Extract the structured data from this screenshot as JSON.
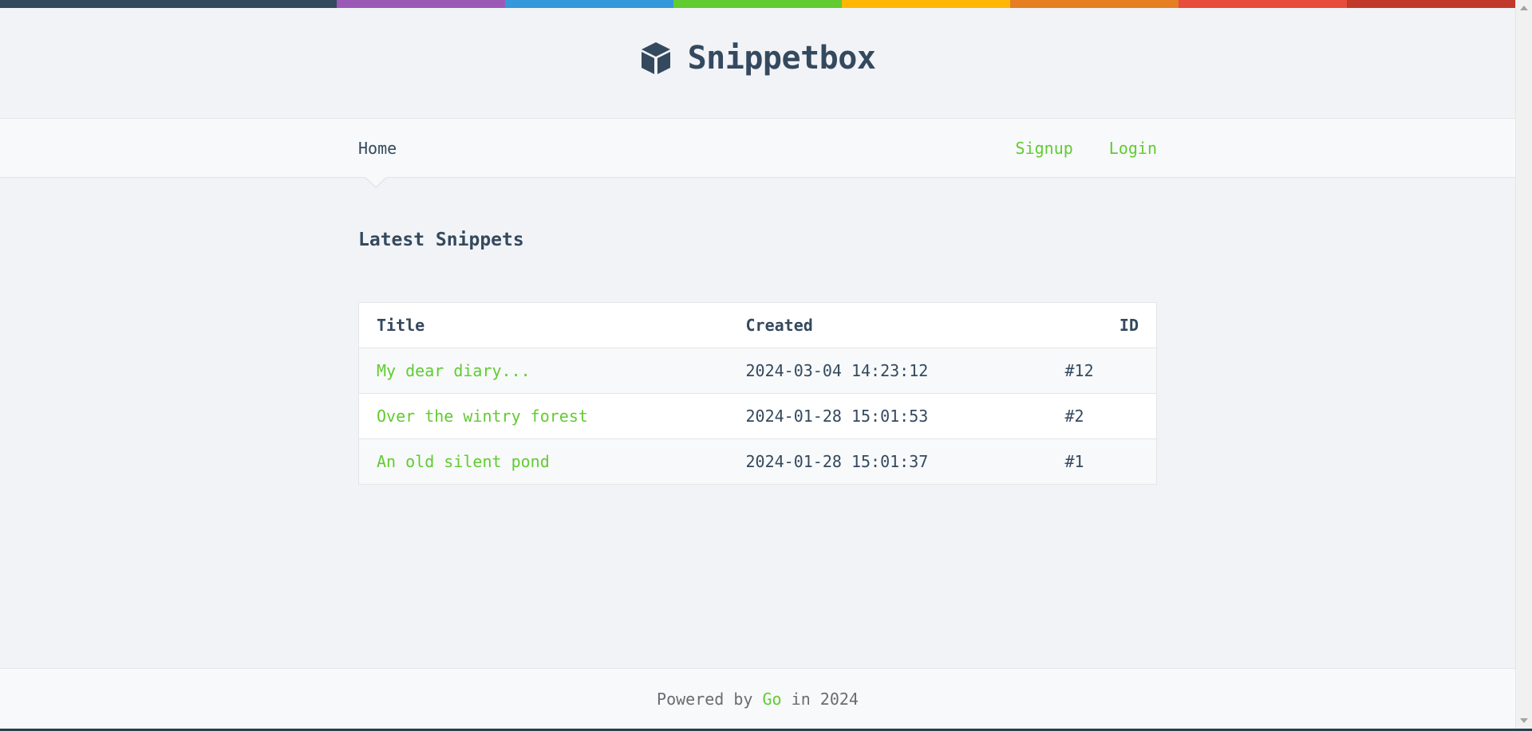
{
  "stripe_colors": [
    "#34495e",
    "#34495e",
    "#9b59b6",
    "#3498db",
    "#62cb31",
    "#ffb606",
    "#e67e22",
    "#e74c3c",
    "#c0392b"
  ],
  "header": {
    "brand_title": "Snippetbox",
    "logo_icon": "cube-icon",
    "text_color": "#34495e"
  },
  "nav": {
    "home_label": "Home",
    "signup_label": "Signup",
    "login_label": "Login",
    "link_color": "#62cb31"
  },
  "main": {
    "title": "Latest Snippets",
    "table": {
      "headers": {
        "title": "Title",
        "created": "Created",
        "id": "ID"
      },
      "rows": [
        {
          "title": "My dear diary...",
          "created": "2024-03-04 14:23:12",
          "id": "#12"
        },
        {
          "title": "Over the wintry forest",
          "created": "2024-01-28 15:01:53",
          "id": "#2"
        },
        {
          "title": "An old silent pond",
          "created": "2024-01-28 15:01:37",
          "id": "#1"
        }
      ]
    }
  },
  "footer": {
    "prefix": "Powered by",
    "link": "Go",
    "suffix": "in 2024"
  }
}
